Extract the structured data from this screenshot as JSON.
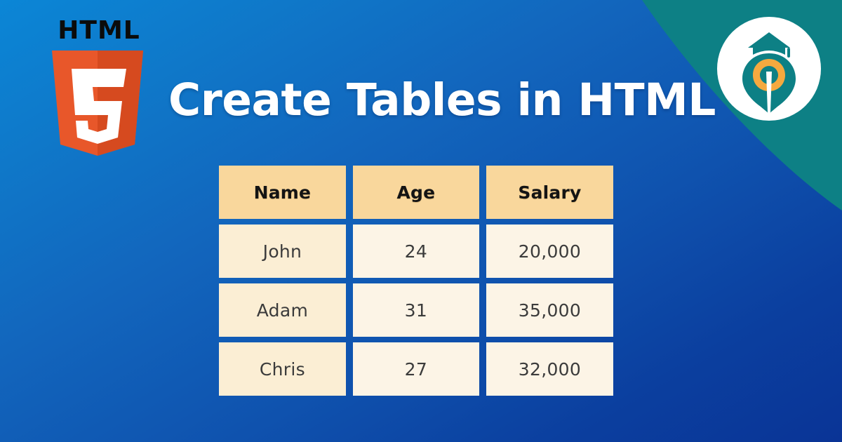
{
  "banner": {
    "title": "Create Tables in HTML",
    "background_gradient_from": "#0b86d6",
    "background_gradient_to": "#0a3496",
    "accent_teal": "#0d8085"
  },
  "html5_logo": {
    "wordmark": "HTML",
    "shield_digit": "5",
    "shield_color_light": "#e8572a",
    "shield_color_dark": "#d64a1f",
    "digit_color": "#ffffff",
    "wordmark_color": "#0b0b0b"
  },
  "brand_logo": {
    "name": "graduation-cap-pen-logo",
    "circle_color": "#ffffff",
    "mark_color": "#0d8085",
    "accent_color": "#f5a93f"
  },
  "table": {
    "headers": [
      "Name",
      "Age",
      "Salary"
    ],
    "header_bg": "#f9d79c",
    "cell_bg": "#fcf4e6",
    "name_cell_bg": "#fbeed4",
    "rows": [
      {
        "name": "John",
        "age": "24",
        "salary": "20,000"
      },
      {
        "name": "Adam",
        "age": "31",
        "salary": "35,000"
      },
      {
        "name": "Chris",
        "age": "27",
        "salary": "32,000"
      }
    ]
  }
}
